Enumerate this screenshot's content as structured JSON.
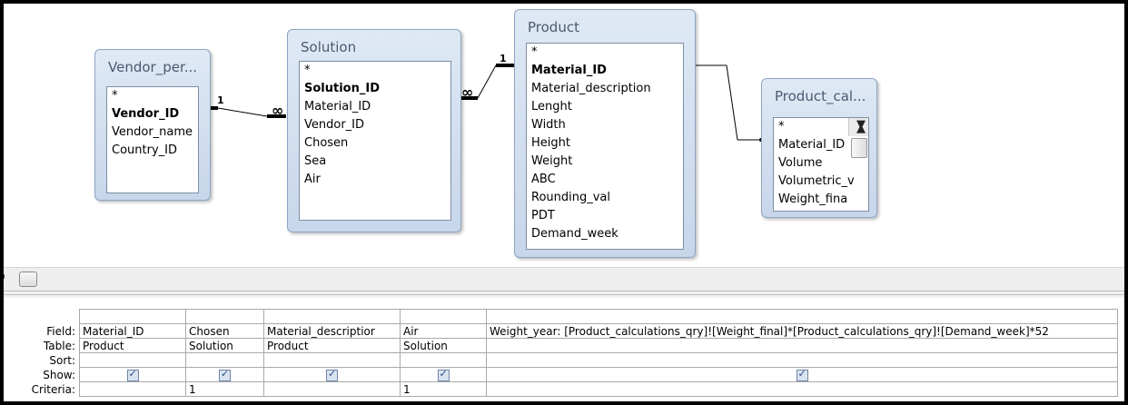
{
  "tables": [
    {
      "name": "Vendor_per...",
      "fields": [
        {
          "label": "*",
          "key": false
        },
        {
          "label": "Vendor_ID",
          "key": true
        },
        {
          "label": "Vendor_name",
          "key": false
        },
        {
          "label": "Country_ID",
          "key": false
        }
      ]
    },
    {
      "name": "Solution",
      "fields": [
        {
          "label": "*",
          "key": false
        },
        {
          "label": "Solution_ID",
          "key": true
        },
        {
          "label": "Material_ID",
          "key": false
        },
        {
          "label": "Vendor_ID",
          "key": false
        },
        {
          "label": "Chosen",
          "key": false
        },
        {
          "label": "Sea",
          "key": false
        },
        {
          "label": "Air",
          "key": false
        }
      ]
    },
    {
      "name": "Product",
      "fields": [
        {
          "label": "*",
          "key": false
        },
        {
          "label": "Material_ID",
          "key": true
        },
        {
          "label": "Material_description",
          "key": false
        },
        {
          "label": "Lenght",
          "key": false
        },
        {
          "label": "Width",
          "key": false
        },
        {
          "label": "Height",
          "key": false
        },
        {
          "label": "Weight",
          "key": false
        },
        {
          "label": "ABC",
          "key": false
        },
        {
          "label": "Rounding_val",
          "key": false
        },
        {
          "label": "PDT",
          "key": false
        },
        {
          "label": "Demand_week",
          "key": false
        }
      ]
    },
    {
      "name": "Product_cal...",
      "fields": [
        {
          "label": "*",
          "key": false
        },
        {
          "label": "Material_ID",
          "key": false
        },
        {
          "label": "Volume",
          "key": false
        },
        {
          "label": "Volumetric_v",
          "key": false
        },
        {
          "label": "Weight_fina",
          "key": false
        }
      ]
    }
  ],
  "relationships": [
    {
      "one_label": "1",
      "many_label": "∞"
    },
    {
      "one_label": "1",
      "many_label": "∞"
    }
  ],
  "grid": {
    "row_labels": {
      "field": "Field:",
      "table": "Table:",
      "sort": "Sort:",
      "show": "Show:",
      "criteria": "Criteria:"
    },
    "columns": [
      {
        "field": "Material_ID",
        "table": "Product",
        "sort": "",
        "show": true,
        "criteria": ""
      },
      {
        "field": "Chosen",
        "table": "Solution",
        "sort": "",
        "show": true,
        "criteria": "1"
      },
      {
        "field": "Material_descriptior",
        "table": "Product",
        "sort": "",
        "show": true,
        "criteria": ""
      },
      {
        "field": "Air",
        "table": "Solution",
        "sort": "",
        "show": true,
        "criteria": "1"
      },
      {
        "field": "Weight_year: [Product_calculations_qry]![Weight_final]*[Product_calculations_qry]![Demand_week]*52",
        "table": "",
        "sort": "",
        "show": true,
        "criteria": ""
      }
    ]
  },
  "icons": {
    "scroll_left": "scroll-left-arrow-icon",
    "check": "checkbox-checked-icon",
    "scroll_up": "scroll-up-arrow-icon",
    "scroll_down": "scroll-down-arrow-icon"
  },
  "colors": {
    "table_header_gradient_top": "#dfe9f5",
    "table_header_gradient_bottom": "#c7d6ea",
    "table_border": "#8ea4c2",
    "checkbox": "#d9e3f0"
  }
}
